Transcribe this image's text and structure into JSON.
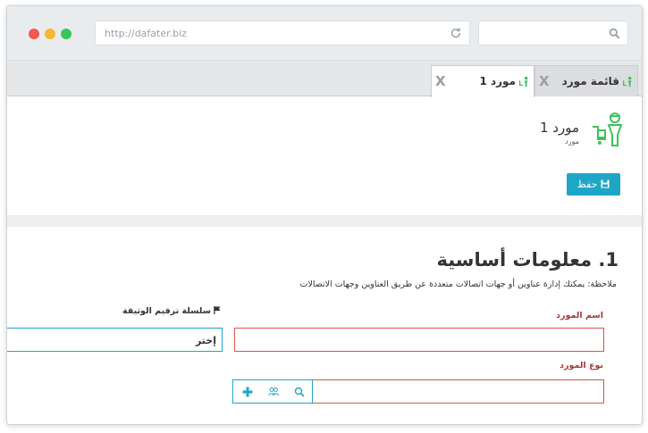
{
  "browser": {
    "url": "http://dafater.biz"
  },
  "tabs": [
    {
      "label": "مورد 1",
      "close": "X",
      "active": true
    },
    {
      "label": "قائمة مورد",
      "close": "X",
      "active": false
    }
  ],
  "entity": {
    "title": "مورد 1",
    "subtitle": "مورد",
    "icon": "supplier-icon"
  },
  "toolbar": {
    "save_label": "حفظ",
    "save_icon": "save-icon",
    "accent": "#1fa6c7"
  },
  "section": {
    "title": "1. معلومات أساسية",
    "note": "ملاحظة: يمكنك إدارة عناوين أو جهات اتصالات متعددة عن طريق العناوين وجهات الاتصالات"
  },
  "fields": {
    "supplier_name_label": "اسم المورد",
    "series_label": "سلسلة ترقيم الوثيقة",
    "series_value": "إختر",
    "supplier_type_label": "نوع المورد"
  },
  "colors": {
    "required_label": "#a33b3b",
    "error_border": "#d9534f",
    "icon_green": "#3cc45c"
  }
}
